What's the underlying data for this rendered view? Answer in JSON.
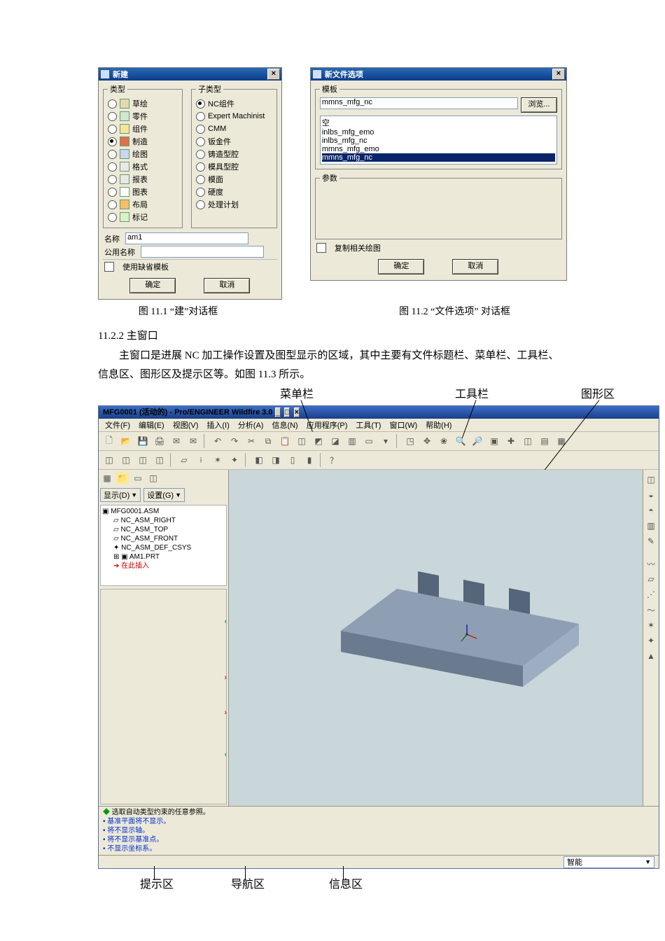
{
  "dlg_new": {
    "title": "新建",
    "group_types_label": "类型",
    "types": [
      "草绘",
      "零件",
      "组件",
      "制造",
      "绘图",
      "格式",
      "报表",
      "图表",
      "布局",
      "标记"
    ],
    "type_selected_index": 3,
    "group_subtypes_label": "子类型",
    "subtypes": [
      "NC组件",
      "Expert Machinist",
      "CMM",
      "钣金件",
      "铸造型腔",
      "模具型腔",
      "模面",
      "硬度",
      "处理计划"
    ],
    "subtype_selected_index": 0,
    "name_label": "名称",
    "name_value": "am1",
    "common_name_label": "公用名称",
    "use_default_template": "使用缺省模板",
    "ok": "确定",
    "cancel": "取消"
  },
  "dlg_opt": {
    "title": "新文件选项",
    "group_templates_label": "模板",
    "template_value": "mmns_mfg_nc",
    "browse": "浏览...",
    "templates": [
      "空",
      "inlbs_mfg_emo",
      "inlbs_mfg_nc",
      "mmns_mfg_emo",
      "mmns_mfg_nc"
    ],
    "template_selected_index": 4,
    "group_params_label": "参数",
    "copy_related_drawings": "复制相关绘图",
    "ok": "确定",
    "cancel": "取消"
  },
  "cap1": "图 11.1  “建”对话框",
  "cap2": "图 11.2 “文件选项” 对话框",
  "section_head": "11.2.2 主窗口",
  "para1": "主窗口是进展 NC 加工操作设置及图型显示的区域，其中主要有文件标题栏、菜单栏、工具栏、信息区、图形区及提示区等。如图 11.3 所示。",
  "ann_top": [
    "菜单栏",
    "工具栏",
    "图形区"
  ],
  "ann_bottom": [
    "提示区",
    "导航区",
    "信息区"
  ],
  "app": {
    "title": "MFG0001 (活动的) - Pro/ENGINEER Wildfire 3.0",
    "menubar": [
      "文件(F)",
      "编辑(E)",
      "视图(V)",
      "插入(I)",
      "分析(A)",
      "信息(N)",
      "应用程序(P)",
      "工具(T)",
      "窗口(W)",
      "帮助(H)"
    ],
    "side_show": "显示(D)",
    "side_set": "设置(G)",
    "tree": {
      "root": "MFG0001.ASM",
      "items": [
        "NC_ASM_RIGHT",
        "NC_ASM_TOP",
        "NC_ASM_FRONT",
        "NC_ASM_DEF_CSYS",
        "AM1.PRT",
        "在此插入"
      ]
    },
    "status_lines": [
      "选取自动类型约束的任意参照。",
      "基准平面将不显示。",
      "将不显示轴。",
      "将不显示基准点。",
      "不显示坐标系。"
    ],
    "status_first_icon_alt": "hint-arrow",
    "smart_label": "智能"
  }
}
